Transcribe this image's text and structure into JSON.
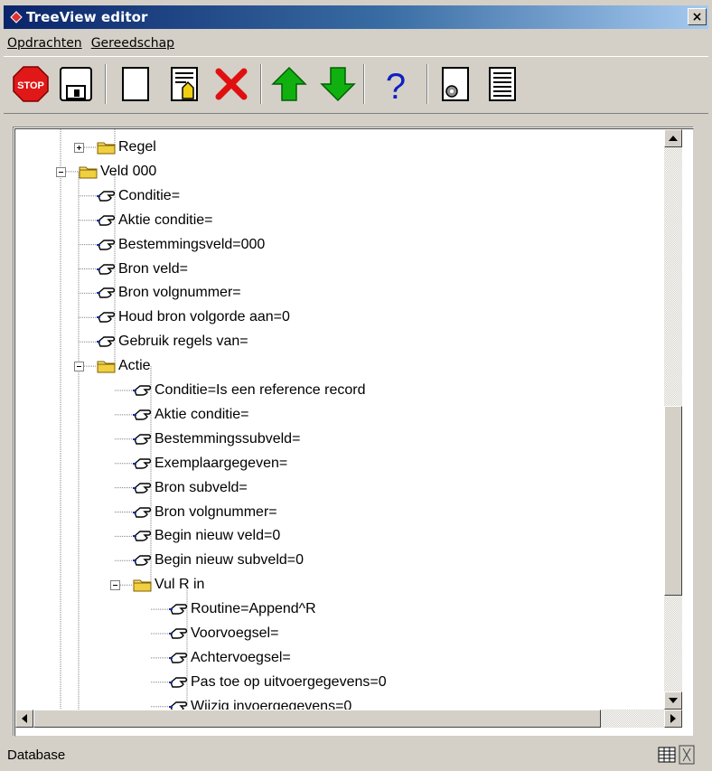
{
  "window": {
    "title": "TreeView editor",
    "close_glyph": "×"
  },
  "menu": [
    {
      "label": "Opdrachten"
    },
    {
      "label": "Gereedschap"
    }
  ],
  "toolbar": [
    {
      "name": "stop-button",
      "icon": "stop-sign-icon",
      "label": "STOP"
    },
    {
      "name": "save-button",
      "icon": "floppy-disk-icon"
    },
    {
      "name": "new-button",
      "icon": "blank-page-icon"
    },
    {
      "name": "edit-button",
      "icon": "edit-document-icon"
    },
    {
      "name": "delete-button",
      "icon": "red-x-icon"
    },
    {
      "name": "move-up-button",
      "icon": "green-arrow-up-icon"
    },
    {
      "name": "move-down-button",
      "icon": "green-arrow-down-icon"
    },
    {
      "name": "help-button",
      "icon": "question-mark-icon"
    },
    {
      "name": "settings-button",
      "icon": "gear-document-icon"
    },
    {
      "name": "list-button",
      "icon": "list-document-icon"
    }
  ],
  "tree": [
    {
      "label": "Regel",
      "type": "folder",
      "expander": "plus"
    },
    {
      "label": "Veld 000",
      "type": "folder",
      "expander": "minus"
    },
    {
      "label": "Conditie=",
      "type": "item"
    },
    {
      "label": "Aktie conditie=",
      "type": "item"
    },
    {
      "label": "Bestemmingsveld=000",
      "type": "item"
    },
    {
      "label": "Bron veld=",
      "type": "item"
    },
    {
      "label": "Bron volgnummer=",
      "type": "item"
    },
    {
      "label": "Houd bron volgorde aan=0",
      "type": "item"
    },
    {
      "label": "Gebruik regels van=",
      "type": "item"
    },
    {
      "label": "Actie",
      "type": "folder",
      "expander": "minus"
    },
    {
      "label": "Conditie=Is een reference record",
      "type": "item"
    },
    {
      "label": "Aktie conditie=",
      "type": "item"
    },
    {
      "label": "Bestemmingssubveld=",
      "type": "item"
    },
    {
      "label": "Exemplaargegeven=",
      "type": "item"
    },
    {
      "label": "Bron subveld=",
      "type": "item"
    },
    {
      "label": "Bron volgnummer=",
      "type": "item"
    },
    {
      "label": "Begin nieuw veld=0",
      "type": "item"
    },
    {
      "label": "Begin nieuw subveld=0",
      "type": "item"
    },
    {
      "label": "Vul R in",
      "type": "folder",
      "expander": "minus"
    },
    {
      "label": "Routine=Append^R",
      "type": "item"
    },
    {
      "label": "Voorvoegsel=",
      "type": "item"
    },
    {
      "label": "Achtervoegsel=",
      "type": "item"
    },
    {
      "label": "Pas toe op uitvoergegevens=0",
      "type": "item"
    },
    {
      "label": "Wijzig invoergegevens=0",
      "type": "item"
    }
  ],
  "status": {
    "text": "Database"
  }
}
